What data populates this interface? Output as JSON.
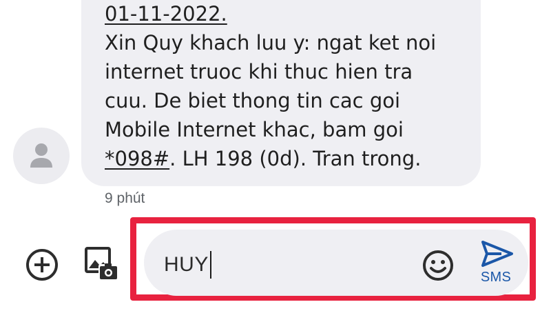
{
  "message": {
    "lines": [
      "01-11-2022.",
      "Xin Quy khach luu y: ngat ket noi",
      "internet truoc khi thuc hien tra",
      "cuu. De biet thong tin cac goi",
      "Mobile Internet khac, bam goi"
    ],
    "last_line_link": "*098#",
    "last_line_rest": ". LH 198 (0d). Tran trong.",
    "timestamp": "9 phút"
  },
  "sender": {
    "avatar_icon": "person-icon"
  },
  "compose": {
    "value": "HUY",
    "add_icon": "plus-circle-icon",
    "gallery_icon": "gallery-camera-icon",
    "emoji_icon": "emoji-icon",
    "send_icon": "send-icon",
    "send_label": "SMS"
  },
  "colors": {
    "bubble": "#efeff3",
    "highlight": "#e8223f",
    "send": "#1b57a8"
  }
}
